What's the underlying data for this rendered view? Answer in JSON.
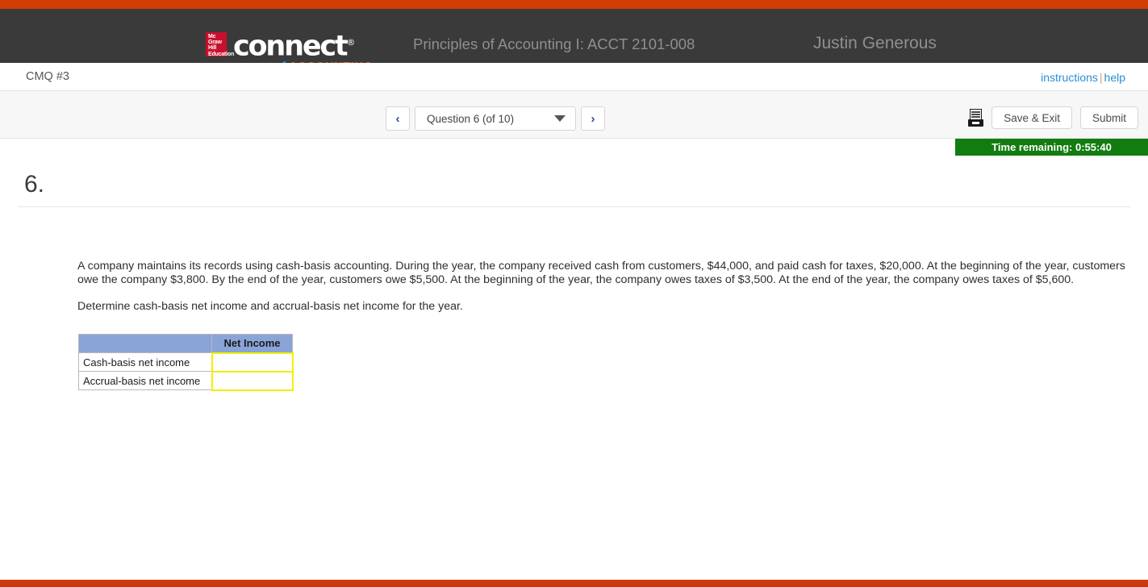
{
  "branding": {
    "mhe_line1": "Mc",
    "mhe_line2": "Graw",
    "mhe_line3": "Hill",
    "mhe_line4": "Education",
    "product_name": "connect",
    "product_trademark": "®",
    "product_subtitle": "ACCOUNTING",
    "accent_orange": "#e8601c",
    "accent_red": "#d23c05"
  },
  "header": {
    "course_title": "Principles of Accounting I: ACCT 2101-008",
    "user_name": "Justin Generous"
  },
  "assignment_bar": {
    "assignment_name": "CMQ #3",
    "instructions_label": "instructions",
    "separator": "|",
    "help_label": "help"
  },
  "toolbar": {
    "prev_icon": "‹",
    "next_icon": "›",
    "question_selector_label": "Question 6 (of 10)",
    "caret_icon": "chevron-down-icon",
    "print_icon": "printer-icon",
    "save_exit_label": "Save & Exit",
    "submit_label": "Submit"
  },
  "timer": {
    "label": "Time remaining: 0:55:40",
    "background": "#127c10"
  },
  "question": {
    "number": "6.",
    "paragraph": "A company maintains its records using cash-basis accounting. During the year, the company received cash from customers, $44,000, and paid cash for taxes, $20,000. At the beginning of the year, customers owe the company $3,800. By the end of the year, customers owe $5,500. At the beginning of the year, the company owes taxes of $3,500. At the end of the year, the company owes taxes of $5,600.",
    "instruction": "Determine cash-basis net income and accrual-basis net income for the year."
  },
  "answer_table": {
    "header_color": "#8aa4d8",
    "columns": [
      "",
      "Net Income"
    ],
    "rows": [
      {
        "label": "Cash-basis net income",
        "value": "",
        "placeholder": ""
      },
      {
        "label": "Accrual-basis net income",
        "value": "",
        "placeholder": ""
      }
    ]
  }
}
